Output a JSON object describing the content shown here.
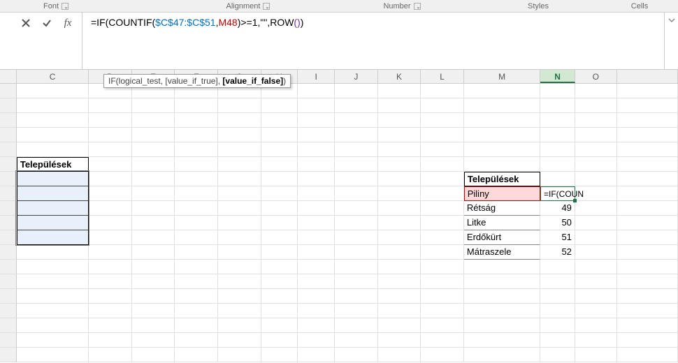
{
  "ribbon": {
    "groups": {
      "font": "Font",
      "alignment": "Alignment",
      "number": "Number",
      "styles": "Styles",
      "cells": "Cells"
    }
  },
  "formula_bar": {
    "raw": "=IF(COUNTIF($C$47:$C$51,M48)>=1,\"\",ROW())",
    "parts": {
      "p1": "=IF(COUNTIF(",
      "ref1": "$C$47:$C$51",
      "comma1": ",",
      "ref2": "M48",
      "p2": ")>=1,\"\",ROW",
      "paren_open": "(",
      "paren_close": ")",
      "p3": ")"
    }
  },
  "tooltip": {
    "prefix": "IF(logical_test, [value_if_true], ",
    "bold": "[value_if_false]",
    "suffix": ")"
  },
  "columns": [
    "C",
    "D",
    "E",
    "F",
    "G",
    "H",
    "I",
    "J",
    "K",
    "L",
    "M",
    "N",
    "O",
    ""
  ],
  "active_column": "N",
  "left_table": {
    "header": "Települések"
  },
  "right_table": {
    "header": "Települések",
    "rows": [
      {
        "name": "Piliny",
        "val": "=IF(COUN"
      },
      {
        "name": "Rétság",
        "val": "49"
      },
      {
        "name": "Litke",
        "val": "50"
      },
      {
        "name": "Erdőkürt",
        "val": "51"
      },
      {
        "name": "Mátraszele",
        "val": "52"
      }
    ]
  }
}
